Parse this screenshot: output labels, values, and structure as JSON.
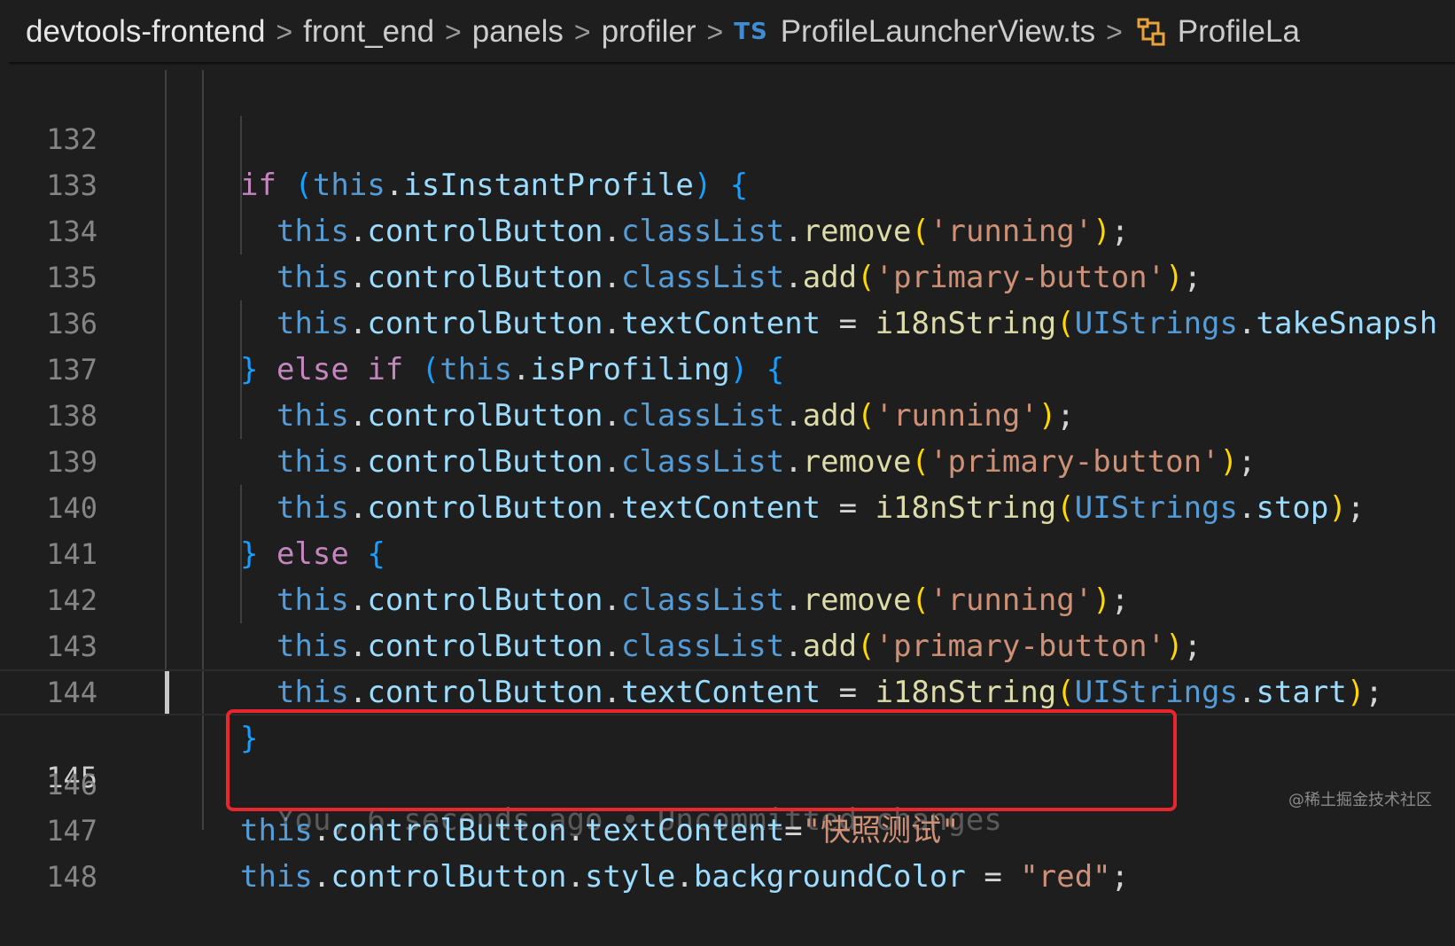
{
  "breadcrumb": {
    "items": [
      "devtools-frontend",
      "front_end",
      "panels",
      "profiler",
      "ProfileLauncherView.ts",
      "ProfileLa"
    ],
    "file_icon": "TS",
    "method_icon": "method-cube-icon",
    "separator": ">"
  },
  "editor": {
    "line_numbers": [
      "132",
      "133",
      "134",
      "135",
      "136",
      "137",
      "138",
      "139",
      "140",
      "141",
      "142",
      "143",
      "144",
      "145",
      "146",
      "147",
      "148"
    ],
    "blame": "You, 6 seconds ago • Uncommitted changes",
    "lines": {
      "l132": {
        "t1": "if",
        "t2": "(",
        "t3": "this",
        "t4": ".",
        "t5": "isInstantProfile",
        "t6": ")",
        "t7": "{"
      },
      "l133": {
        "t1": "this",
        "t2": ".",
        "t3": "controlButton",
        "t4": ".",
        "t5": "classList",
        "t6": ".",
        "t7": "remove",
        "t8": "(",
        "t9": "'running'",
        "t10": ")",
        "t11": ";"
      },
      "l134": {
        "t1": "this",
        "t2": ".",
        "t3": "controlButton",
        "t4": ".",
        "t5": "classList",
        "t6": ".",
        "t7": "add",
        "t8": "(",
        "t9": "'primary-button'",
        "t10": ")",
        "t11": ";"
      },
      "l135": {
        "t1": "this",
        "t2": ".",
        "t3": "controlButton",
        "t4": ".",
        "t5": "textContent",
        "t6": " = ",
        "t7": "i18nString",
        "t8": "(",
        "t9": "UIStrings",
        "t10": ".",
        "t11": "takeSnapsh"
      },
      "l136": {
        "t1": "}",
        "t2": " else ",
        "t3": "if",
        "t4": "(",
        "t5": "this",
        "t6": ".",
        "t7": "isProfiling",
        "t8": ")",
        "t9": "{"
      },
      "l137": {
        "t1": "this",
        "t2": ".",
        "t3": "controlButton",
        "t4": ".",
        "t5": "classList",
        "t6": ".",
        "t7": "add",
        "t8": "(",
        "t9": "'running'",
        "t10": ")",
        "t11": ";"
      },
      "l138": {
        "t1": "this",
        "t2": ".",
        "t3": "controlButton",
        "t4": ".",
        "t5": "classList",
        "t6": ".",
        "t7": "remove",
        "t8": "(",
        "t9": "'primary-button'",
        "t10": ")",
        "t11": ";"
      },
      "l139": {
        "t1": "this",
        "t2": ".",
        "t3": "controlButton",
        "t4": ".",
        "t5": "textContent",
        "t6": " = ",
        "t7": "i18nString",
        "t8": "(",
        "t9": "UIStrings",
        "t10": ".",
        "t11": "stop",
        "t12": ")",
        "t13": ";"
      },
      "l140": {
        "t1": "}",
        "t2": " else ",
        "t3": "{"
      },
      "l141": {
        "t1": "this",
        "t2": ".",
        "t3": "controlButton",
        "t4": ".",
        "t5": "classList",
        "t6": ".",
        "t7": "remove",
        "t8": "(",
        "t9": "'running'",
        "t10": ")",
        "t11": ";"
      },
      "l142": {
        "t1": "this",
        "t2": ".",
        "t3": "controlButton",
        "t4": ".",
        "t5": "classList",
        "t6": ".",
        "t7": "add",
        "t8": "(",
        "t9": "'primary-button'",
        "t10": ")",
        "t11": ";"
      },
      "l143": {
        "t1": "this",
        "t2": ".",
        "t3": "controlButton",
        "t4": ".",
        "t5": "textContent",
        "t6": " = ",
        "t7": "i18nString",
        "t8": "(",
        "t9": "UIStrings",
        "t10": ".",
        "t11": "start",
        "t12": ")",
        "t13": ";"
      },
      "l144": {
        "t1": "}"
      },
      "l146": {
        "t1": "this",
        "t2": ".",
        "t3": "controlButton",
        "t4": ".",
        "t5": "textContent",
        "t6": "=",
        "t7": "\"快照测试\""
      },
      "l147": {
        "t1": "this",
        "t2": ".",
        "t3": "controlButton",
        "t4": ".",
        "t5": "style",
        "t6": ".",
        "t7": "backgroundColor",
        "t8": " = ",
        "t9": "\"red\"",
        "t10": ";"
      }
    }
  },
  "highlight": {
    "color": "#e8262f"
  },
  "watermark": "@稀土掘金技术社区",
  "colors": {
    "background": "#1e1e1e",
    "keyword": "#c586c0",
    "this": "#569cd6",
    "property": "#9cdcfe",
    "method": "#dcdcaa",
    "string": "#ce9178",
    "class": "#4ec9b0",
    "bracket_gold": "#ffd700",
    "bracket_purple": "#da70d6",
    "bracket_blue": "#179fff"
  }
}
